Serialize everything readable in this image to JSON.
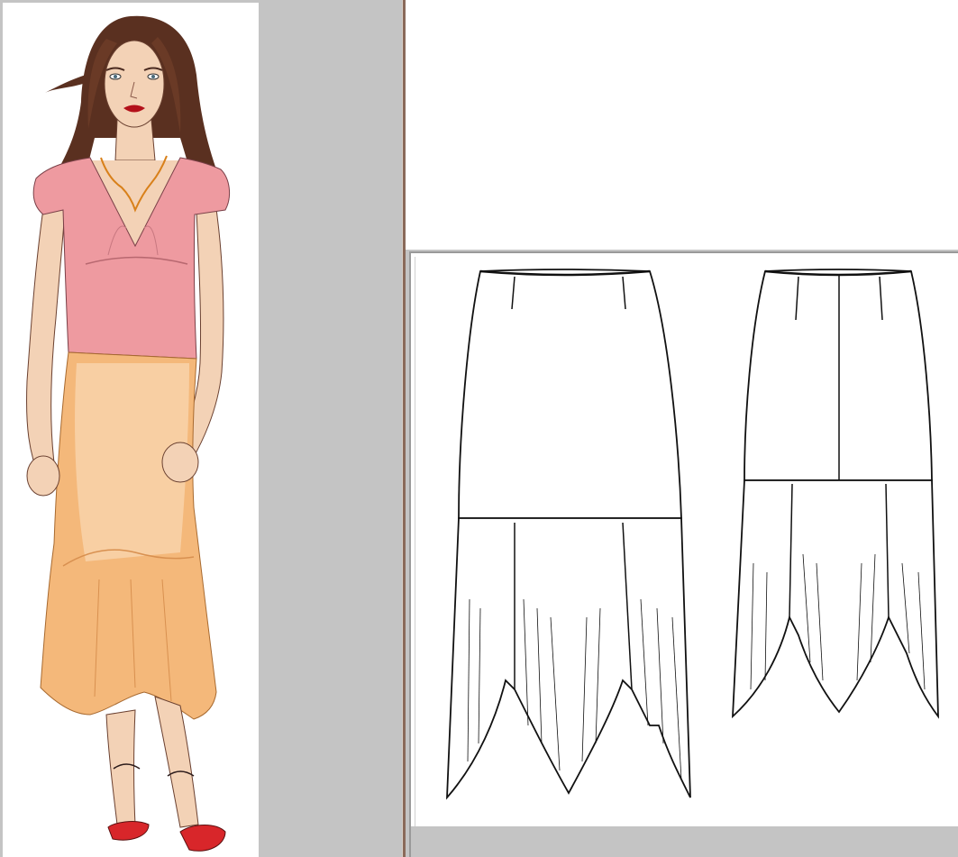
{
  "canvas": {
    "background": "#c4c4c4",
    "panel_background": "#ffffff"
  },
  "illustration": {
    "subject": "fashion-model-figure",
    "colors": {
      "hair": "#5a3020",
      "skin": "#f3d2b6",
      "top": "#ee9aa0",
      "skirt": "#f4b87a",
      "skirt_light": "#fbe2c4",
      "shoes": "#d8262a",
      "lips": "#b3101a"
    }
  },
  "flat_sketches": {
    "items": [
      {
        "view": "front",
        "icon": "skirt-front-flat-icon"
      },
      {
        "view": "back",
        "icon": "skirt-back-flat-icon"
      }
    ],
    "line_color": "#111111"
  }
}
